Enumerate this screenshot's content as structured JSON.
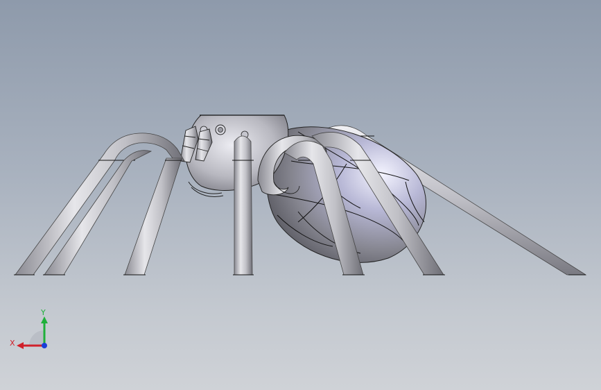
{
  "viewport": {
    "background_top": "#8e9aab",
    "background_bottom": "#cfd2d7"
  },
  "model": {
    "subject": "spider-3d-model",
    "shading": "shaded-with-edges",
    "body_color": "#c8c8cc",
    "edge_color": "#1a1a1a"
  },
  "triad": {
    "x_label": "X",
    "y_label": "Y",
    "x_color": "#d0202a",
    "y_color": "#1fb03a",
    "z_color": "#1a3fd8"
  }
}
